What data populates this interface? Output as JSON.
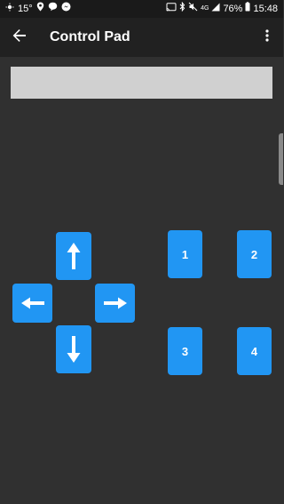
{
  "status_bar": {
    "temperature": "15°",
    "signal_type": "4G",
    "battery": "76%",
    "time": "15:48",
    "icons_left": [
      "weather-icon",
      "location-pin-icon",
      "chat-icon",
      "messenger-icon"
    ],
    "icons_right": [
      "cast-icon",
      "bluetooth-icon",
      "mute-icon",
      "cell-signal-icon",
      "battery-icon"
    ]
  },
  "app_bar": {
    "title": "Control Pad",
    "back_icon": "arrow-back-icon",
    "menu_icon": "more-vert-icon"
  },
  "display": {
    "value": ""
  },
  "dpad": {
    "up_icon": "arrow-up-icon",
    "down_icon": "arrow-down-icon",
    "left_icon": "arrow-left-icon",
    "right_icon": "arrow-right-icon"
  },
  "number_buttons": {
    "b1": "1",
    "b2": "2",
    "b3": "3",
    "b4": "4"
  },
  "colors": {
    "background": "#303030",
    "app_bar": "#212121",
    "status_bar": "#1a1a1a",
    "button": "#2196f3",
    "display": "#d0d0d0"
  }
}
